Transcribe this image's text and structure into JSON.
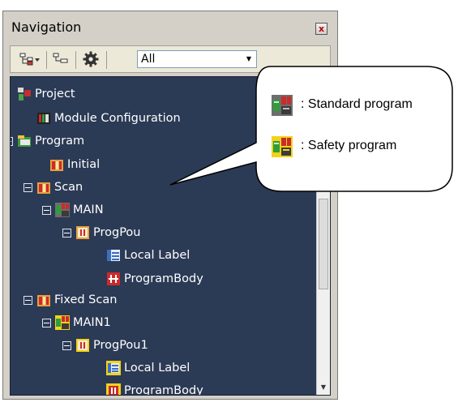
{
  "window": {
    "title": "Navigation",
    "close_glyph": "x"
  },
  "toolbar": {
    "filter_value": "All"
  },
  "tree": [
    {
      "label": "Project",
      "icon": "project-icon",
      "expander": false
    },
    {
      "label": "Module Configuration",
      "icon": "module-configuration-icon",
      "expander": false
    },
    {
      "label": "Program",
      "icon": "program-folder-icon",
      "expander": true
    },
    {
      "label": "Initial",
      "icon": "program-type-icon",
      "expander": false
    },
    {
      "label": "Scan",
      "icon": "program-type-icon",
      "expander": true
    },
    {
      "label": "MAIN",
      "icon": "standard-program-icon",
      "expander": true
    },
    {
      "label": "ProgPou",
      "icon": "pou-icon",
      "expander": true
    },
    {
      "label": "Local Label",
      "icon": "local-label-icon",
      "expander": false
    },
    {
      "label": "ProgramBody",
      "icon": "program-body-icon",
      "expander": false
    },
    {
      "label": "Fixed Scan",
      "icon": "program-type-icon",
      "expander": true
    },
    {
      "label": "MAIN1",
      "icon": "safety-program-icon",
      "expander": true
    },
    {
      "label": "ProgPou1",
      "icon": "pou-safety-icon",
      "expander": true
    },
    {
      "label": "Local Label",
      "icon": "local-label-safety-icon",
      "expander": false
    },
    {
      "label": "ProgramBody",
      "icon": "program-body-safety-icon",
      "expander": false
    }
  ],
  "legend": {
    "standard": ": Standard program",
    "safety": ": Safety program"
  },
  "colors": {
    "tree_background": "#2b3a55",
    "safety_yellow": "#f2d21b",
    "standard_gray": "#6a6a6a"
  }
}
